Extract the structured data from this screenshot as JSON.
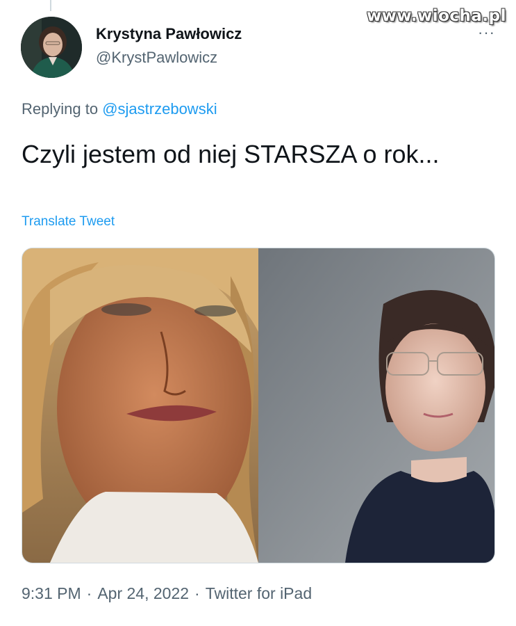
{
  "watermark": "www.wiocha.pl",
  "author": {
    "name": "Krystyna Pawłowicz",
    "handle": "@KrystPawlowicz"
  },
  "more_icon": "···",
  "reply": {
    "prefix": "Replying to",
    "mention": "@sjastrzebowski"
  },
  "tweet": {
    "text": "Czyli jestem od niej STARSZA o rok...",
    "translate_label": "Translate Tweet"
  },
  "meta": {
    "time": "9:31 PM",
    "date": "Apr 24, 2022",
    "separator": "·",
    "source": "Twitter for iPad"
  },
  "colors": {
    "accent": "#1d9bf0",
    "text_primary": "#0f1419",
    "text_secondary": "#536471",
    "border": "#cfd9de"
  }
}
